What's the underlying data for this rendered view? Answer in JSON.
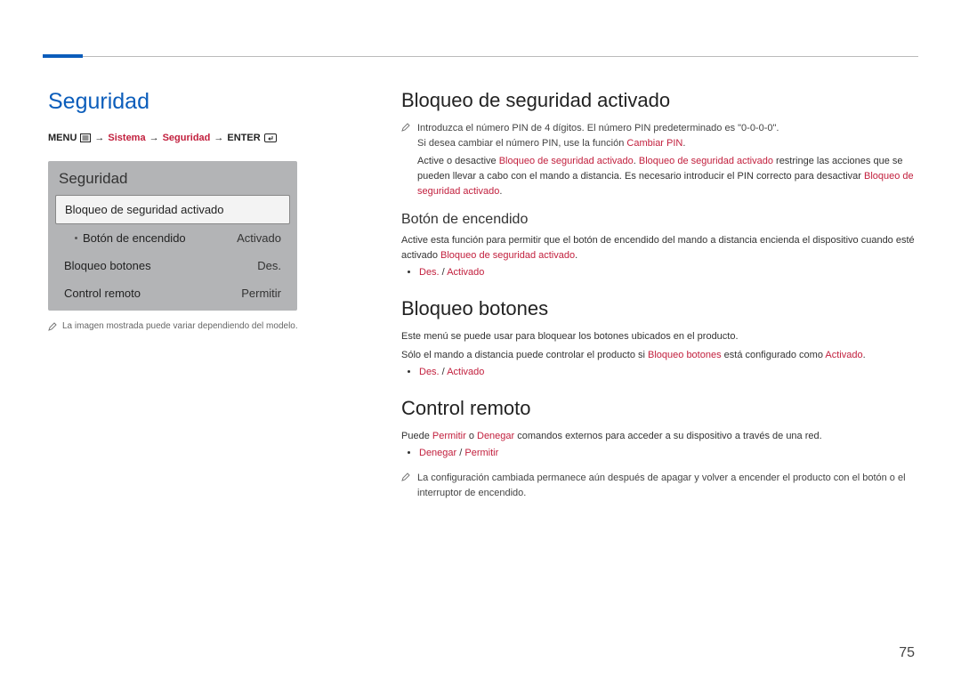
{
  "page_number": "75",
  "left": {
    "heading": "Seguridad",
    "breadcrumb": {
      "menu": "MENU",
      "p1": "Sistema",
      "p2": "Seguridad",
      "enter": "ENTER"
    },
    "panel": {
      "title": "Seguridad",
      "items": [
        {
          "label": "Bloqueo de seguridad activado",
          "value": "",
          "selected": true,
          "sub": false
        },
        {
          "label": "Botón de encendido",
          "value": "Activado",
          "selected": false,
          "sub": true
        },
        {
          "label": "Bloqueo botones",
          "value": "Des.",
          "selected": false,
          "sub": false
        },
        {
          "label": "Control remoto",
          "value": "Permitir",
          "selected": false,
          "sub": false
        }
      ]
    },
    "caption": "La imagen mostrada puede variar dependiendo del modelo."
  },
  "right": {
    "s1": {
      "heading": "Bloqueo de seguridad activado",
      "note1a": "Introduzca el número PIN de 4 dígitos. El número PIN predeterminado es \"0-0-0-0\".",
      "note1b_pre": "Si desea cambiar el número PIN, use la función ",
      "note1b_em": "Cambiar PIN",
      "p_pre": "Active o desactive ",
      "p_em1": "Bloqueo de seguridad activado",
      "p_mid1": ". ",
      "p_em2": "Bloqueo de seguridad activado",
      "p_mid2": " restringe las acciones que se pueden llevar a cabo con el mando a distancia. Es necesario introducir el PIN correcto para desactivar ",
      "p_em3": "Bloqueo de seguridad activado",
      "sub": {
        "heading": "Botón de encendido",
        "p_pre": "Active esta función para permitir que el botón de encendido del mando a distancia encienda el dispositivo cuando esté activado ",
        "p_em": "Bloqueo de seguridad activado",
        "opt1": "Des.",
        "sep": " / ",
        "opt2": "Activado"
      }
    },
    "s2": {
      "heading": "Bloqueo botones",
      "p1": "Este menú se puede usar para bloquear los botones ubicados en el producto.",
      "p2_pre": "Sólo el mando a distancia puede controlar el producto si ",
      "p2_em1": "Bloqueo botones",
      "p2_mid": " está configurado como ",
      "p2_em2": "Activado",
      "opt1": "Des.",
      "sep": " / ",
      "opt2": "Activado"
    },
    "s3": {
      "heading": "Control remoto",
      "p_pre": "Puede ",
      "p_em1": "Permitir",
      "p_mid1": " o ",
      "p_em2": "Denegar",
      "p_mid2": " comandos externos para acceder a su dispositivo a través de una red.",
      "opt1": "Denegar",
      "sep": " / ",
      "opt2": "Permitir",
      "note": "La configuración cambiada permanece aún después de apagar y volver a encender el producto con el botón o el interruptor de encendido."
    }
  }
}
